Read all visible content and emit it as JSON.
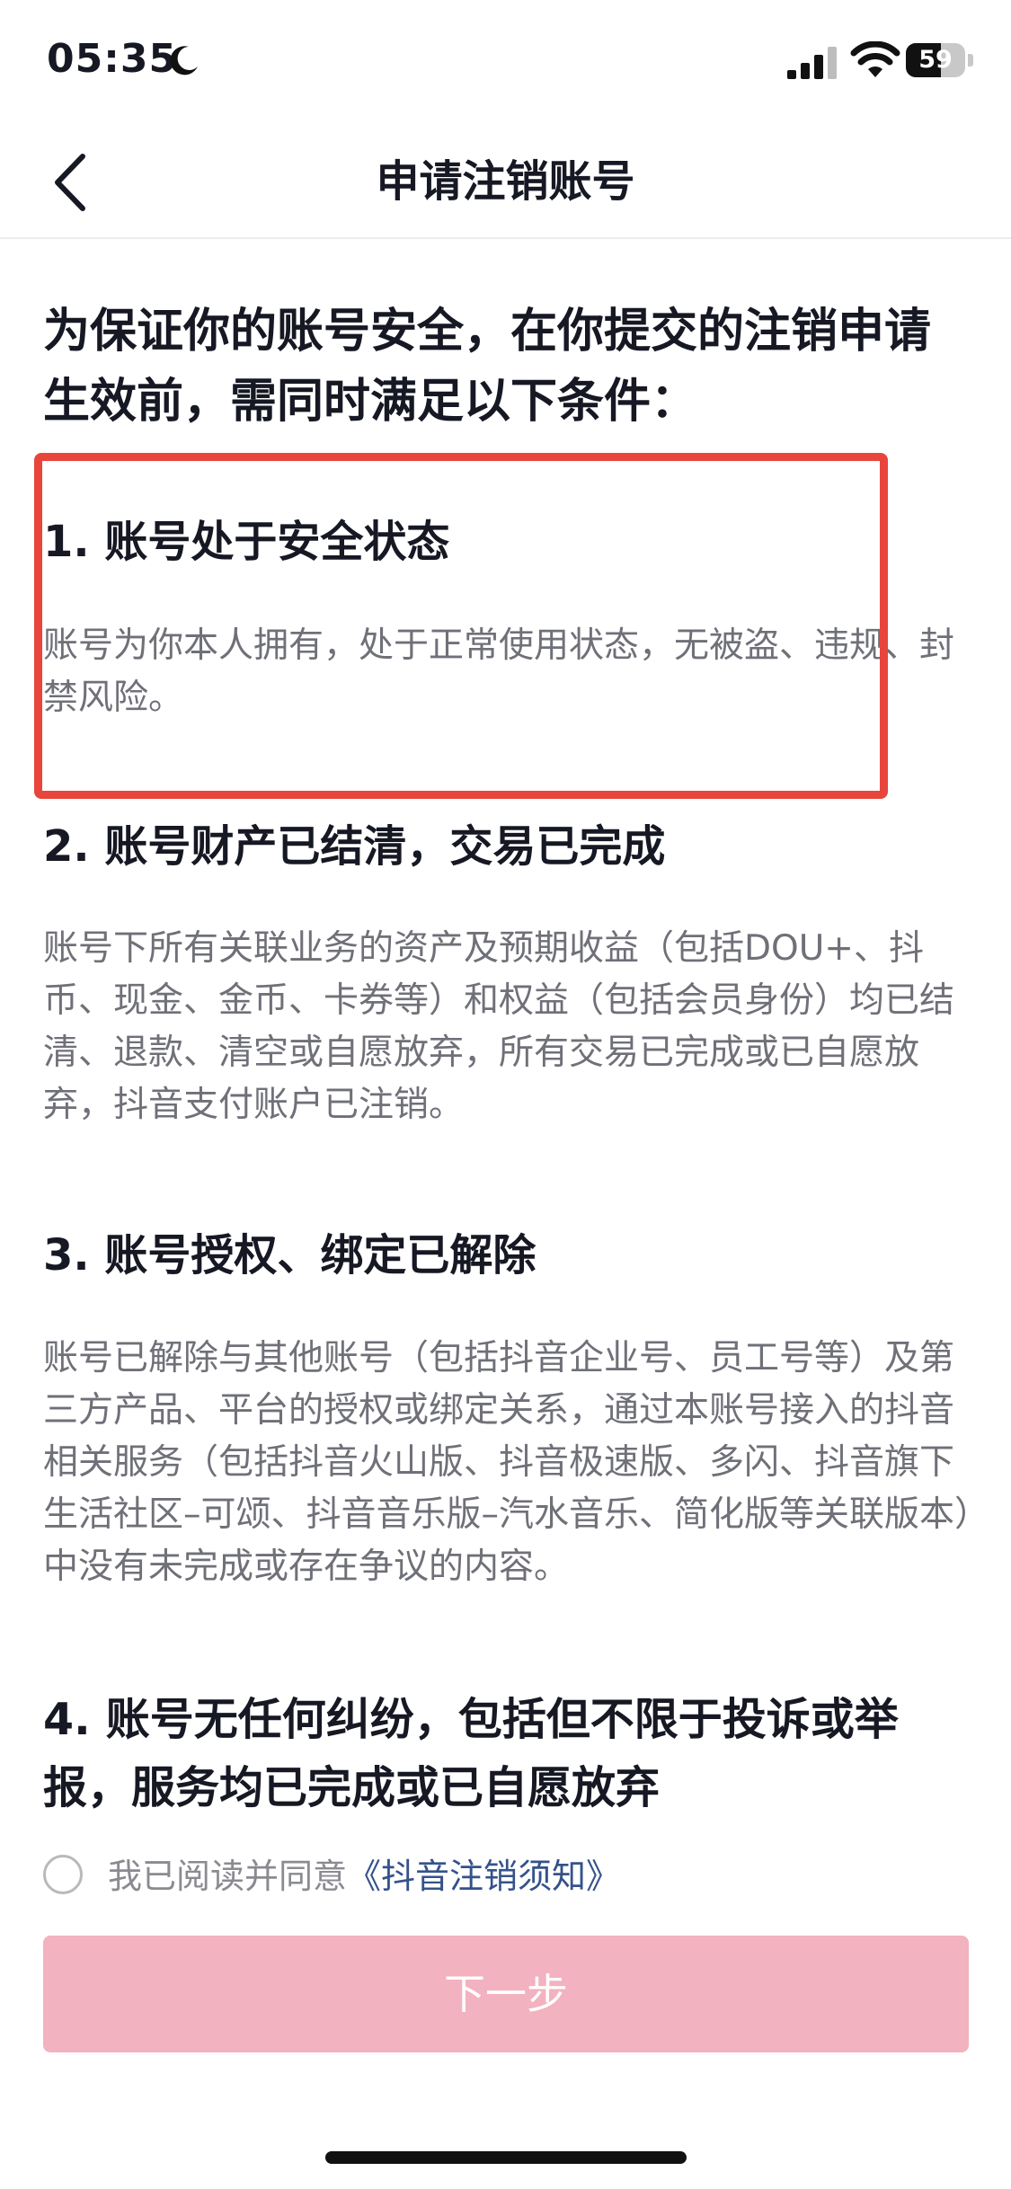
{
  "status_bar": {
    "time": "05:35",
    "battery_level": "59",
    "battery_fraction": 0.59
  },
  "nav": {
    "title": "申请注销账号",
    "back_icon": "chevron-left-icon"
  },
  "intro": "为保证你的账号安全，在你提交的注销申请生效前，需同时满足以下条件：",
  "sections": [
    {
      "title": "1. 账号处于安全状态",
      "body": "账号为你本人拥有，处于正常使用状态，无被盗、违规、封禁风险。"
    },
    {
      "title": "2. 账号财产已结清，交易已完成",
      "body": "账号下所有关联业务的资产及预期收益（包括DOU+、抖币、现金、金币、卡券等）和权益（包括会员身份）均已结清、退款、清空或自愿放弃，所有交易已完成或已自愿放弃，抖音支付账户已注销。"
    },
    {
      "title": "3. 账号授权、绑定已解除",
      "body": "账号已解除与其他账号（包括抖音企业号、员工号等）及第三方产品、平台的授权或绑定关系，通过本账号接入的抖音相关服务（包括抖音火山版、抖音极速版、多闪、抖音旗下生活社区–可颂、抖音音乐版–汽水音乐、简化版等关联版本）中没有未完成或存在争议的内容。"
    },
    {
      "title": "4. 账号无任何纠纷，包括但不限于投诉或举报，服务均已完成或已自愿放弃"
    }
  ],
  "agreement": {
    "prefix": "我已阅读并同意",
    "link": "《抖音注销须知》",
    "checked": false
  },
  "next_button": {
    "label": "下一步",
    "enabled": false
  },
  "colors": {
    "highlight_border": "#e8453d",
    "button_disabled": "#f2b2bf",
    "link": "#35528a",
    "body_text": "#6f7078"
  }
}
